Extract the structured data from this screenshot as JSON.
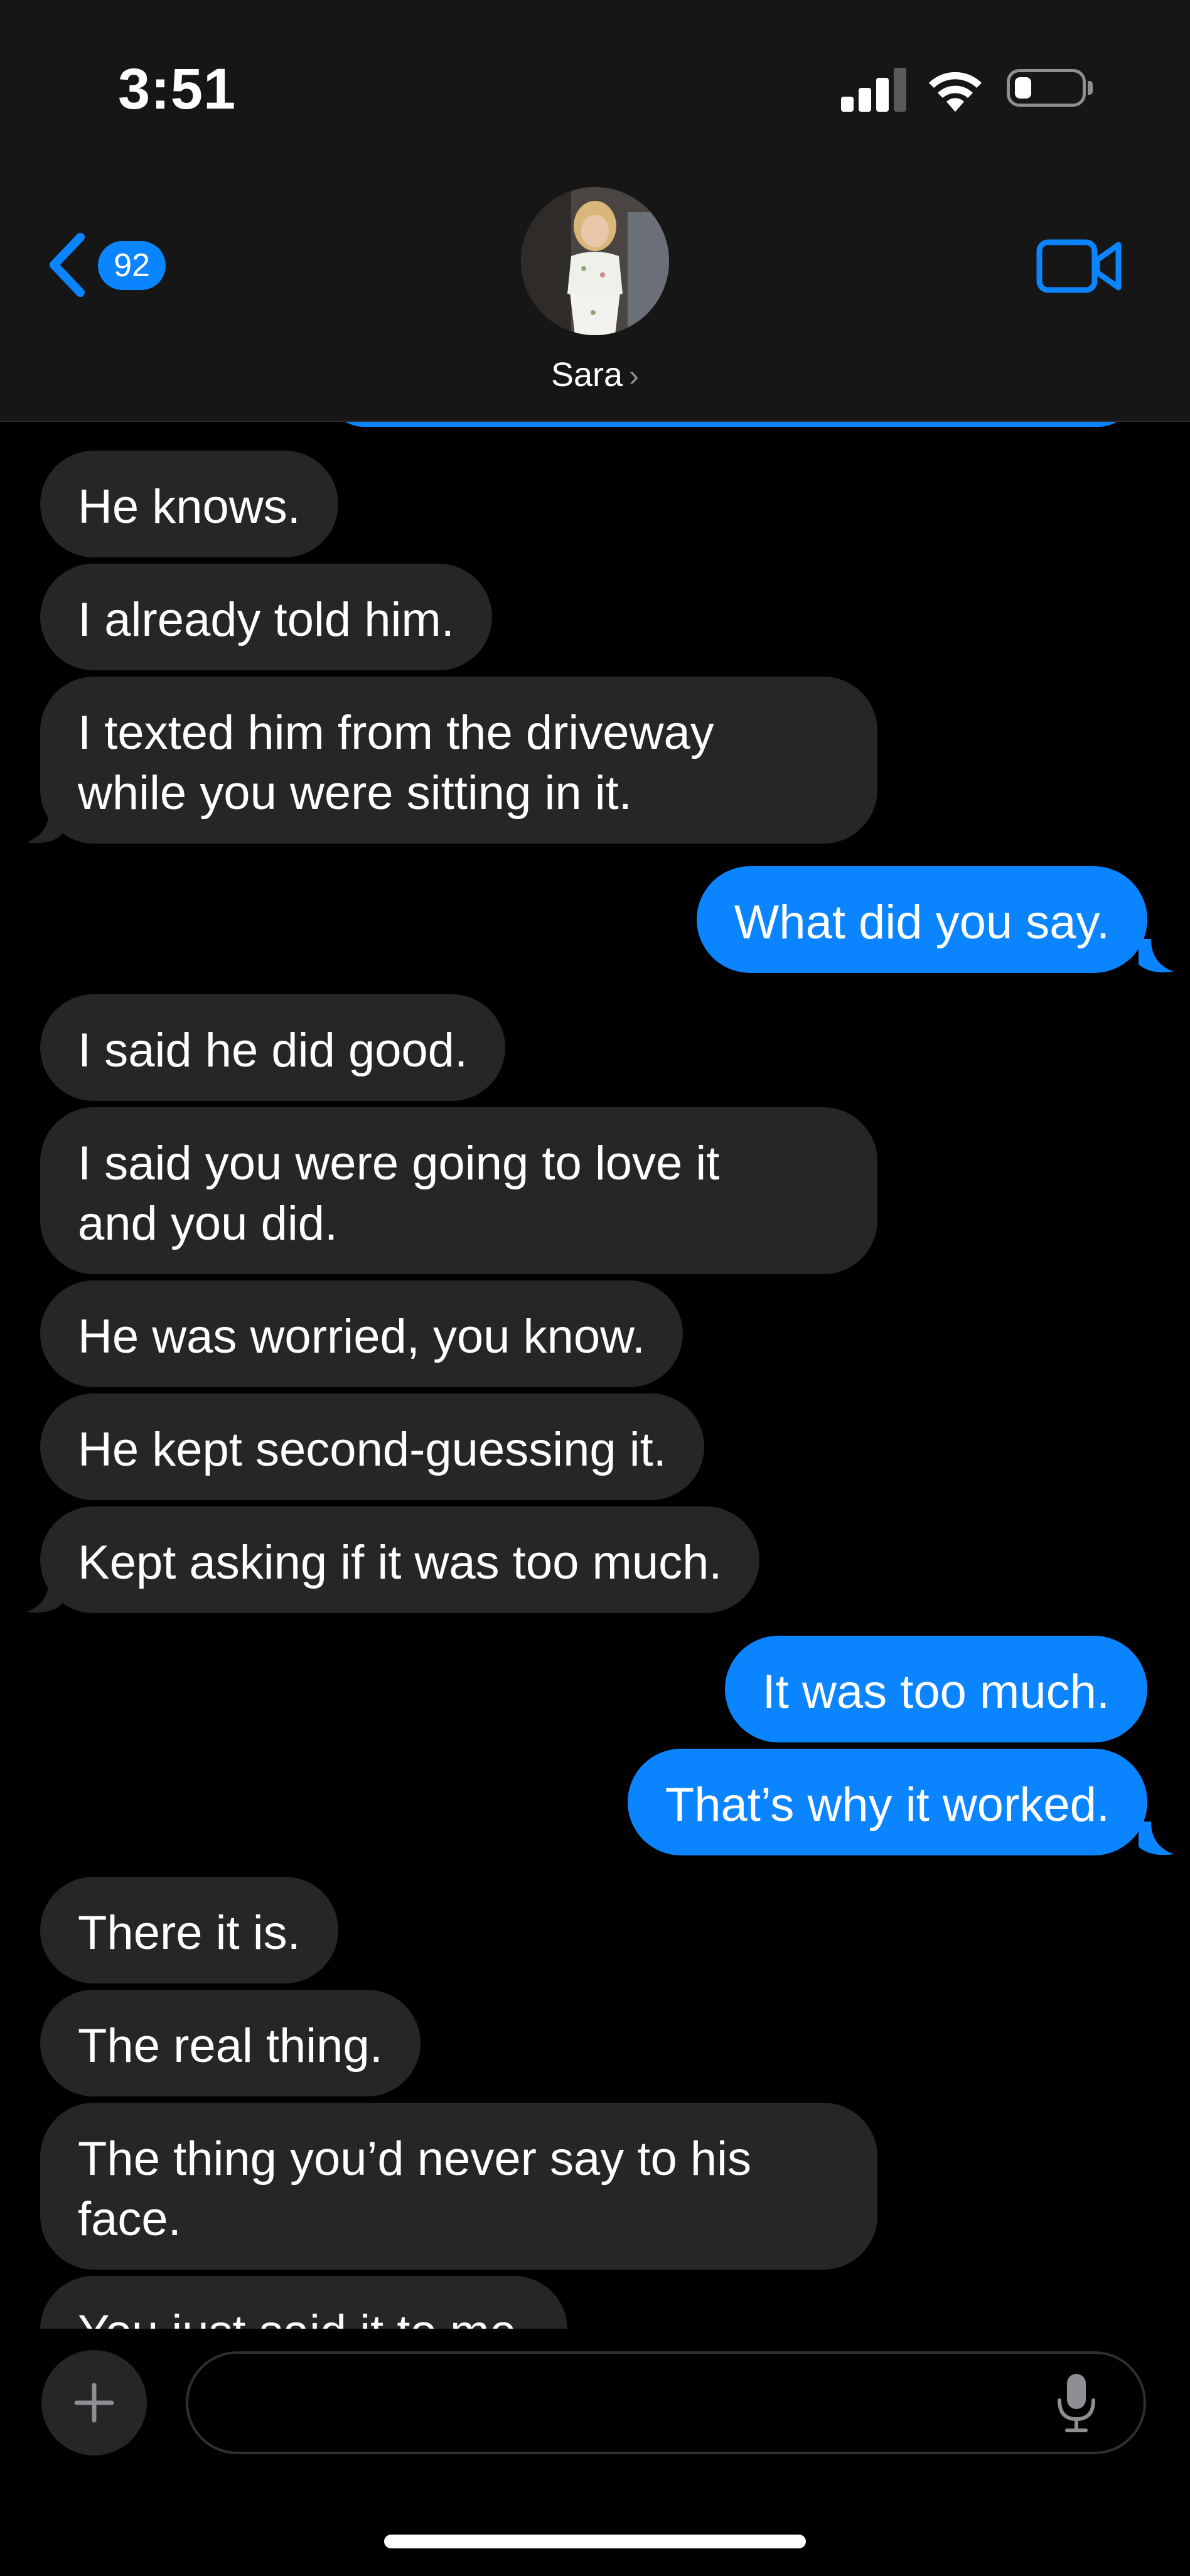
{
  "status_bar": {
    "time": "3:51"
  },
  "header": {
    "back_badge_count": "92",
    "contact_name": "Sara",
    "name_chevron": "›",
    "icons": {
      "back": "chevron-left-icon",
      "video": "video-camera-icon"
    },
    "accent_color": "#0a84ff"
  },
  "messages": [
    {
      "direction": "in",
      "text": "He knows."
    },
    {
      "direction": "in",
      "text": "I already told him."
    },
    {
      "direction": "in",
      "text": "I texted him from the driveway\nwhile you were sitting in it."
    },
    {
      "direction": "out",
      "text": "What did you say."
    },
    {
      "direction": "in",
      "text": "I said he did good."
    },
    {
      "direction": "in",
      "text": "I said you were going to love it\nand you did."
    },
    {
      "direction": "in",
      "text": "He was worried, you know."
    },
    {
      "direction": "in",
      "text": "He kept second-guessing it."
    },
    {
      "direction": "in",
      "text": "Kept asking if it was too much."
    },
    {
      "direction": "out",
      "text": "It was too much."
    },
    {
      "direction": "out",
      "text": "That’s why it worked."
    },
    {
      "direction": "in",
      "text": "There it is."
    },
    {
      "direction": "in",
      "text": "The real thing."
    },
    {
      "direction": "in",
      "text": "The thing you’d never say to his\nface."
    },
    {
      "direction": "in",
      "text": "You just said it to me."
    }
  ],
  "composer": {
    "input_value": "",
    "plus_label": "+",
    "icons": {
      "add": "plus-icon",
      "mic": "microphone-icon"
    }
  },
  "colors": {
    "incoming_bubble": "#262629",
    "outgoing_bubble": "#0a84ff",
    "background": "#000000"
  }
}
